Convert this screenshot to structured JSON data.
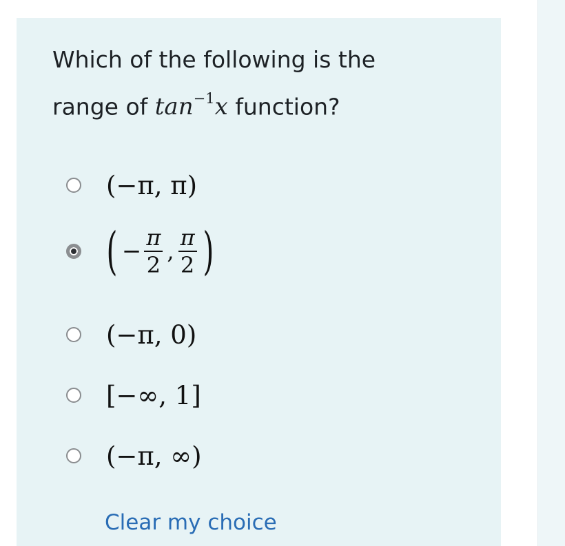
{
  "question": {
    "prefix_line1": "Which of the following is the",
    "prefix_line2": "range of",
    "math_base": "tan",
    "math_exp": "−1",
    "math_var": "x",
    "suffix": " function?"
  },
  "options": [
    {
      "label": "(−π, π)",
      "selected": false
    },
    {
      "label_parts": {
        "open": "(",
        "minus": "−",
        "num1": "π",
        "den1": "2",
        "comma": ",",
        "num2": "π",
        "den2": "2",
        "close": ")"
      },
      "selected": true
    },
    {
      "label": "(−π, 0)",
      "selected": false
    },
    {
      "label": "[−∞, 1]",
      "selected": false
    },
    {
      "label": "(−π, ∞)",
      "selected": false
    }
  ],
  "clear_link": "Clear my choice",
  "colors": {
    "card_bg": "#e7f3f5",
    "link": "#2a6db5",
    "text": "#1d2125"
  }
}
